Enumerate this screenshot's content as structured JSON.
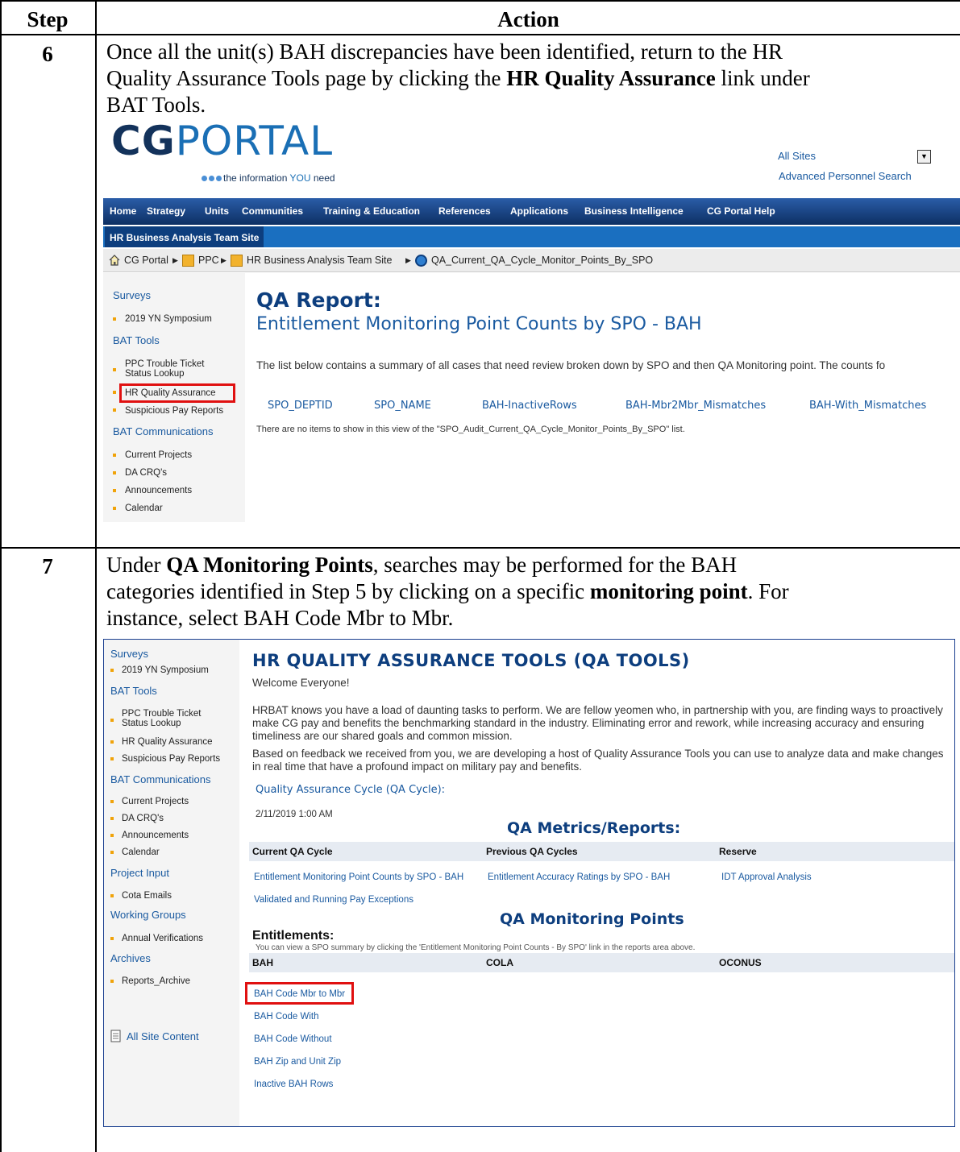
{
  "table": {
    "col_step": "Step",
    "col_action": "Action"
  },
  "step6": {
    "number": "6",
    "line1": "Once all the unit(s) BAH discrepancies have been identified, return to the HR",
    "line2_a": "Quality Assurance Tools page by clicking the ",
    "line2_b": "HR Quality Assurance",
    "line2_c": " link under",
    "line3": "BAT Tools."
  },
  "step7": {
    "number": "7",
    "line1_a": "Under ",
    "line1_b": "QA Monitoring Points",
    "line1_c": ", searches may be performed for the BAH",
    "line2_a": "categories identified in Step 5 by clicking on a specific ",
    "line2_b": "monitoring point",
    "line2_c": ".  For",
    "line3": "instance, select BAH Code Mbr to Mbr."
  },
  "shot1": {
    "logo_cg": "CG",
    "logo_portal": "PORTAL",
    "tagline_a": "the information ",
    "tagline_b": "YOU",
    "tagline_c": " need",
    "sites_value": "All Sites",
    "advanced_search": "Advanced Personnel Search",
    "topnav": [
      "Home",
      "Strategy",
      "Units",
      "Communities",
      "Training & Education",
      "References",
      "Applications",
      "Business Intelligence",
      "CG Portal Help"
    ],
    "subtab": "HR Business Analysis Team Site",
    "breadcrumb": [
      "CG Portal",
      "PPC",
      "HR Business Analysis Team Site",
      "QA_Current_QA_Cycle_Monitor_Points_By_SPO"
    ],
    "nav": {
      "surveys": "Surveys",
      "symposium": "2019 YN Symposium",
      "bat_tools": "BAT Tools",
      "ppc_ticket_1": "PPC Trouble Ticket",
      "ppc_ticket_2": "Status Lookup",
      "hr_qa": "HR Quality Assurance",
      "suspicious": "Suspicious Pay Reports",
      "bat_comm": "BAT Communications",
      "current_projects": "Current Projects",
      "da_crq": "DA CRQ's",
      "announcements": "Announcements",
      "calendar": "Calendar"
    },
    "report_title": "QA Report:",
    "report_subtitle": "Entitlement Monitoring Point Counts by SPO - BAH",
    "description": "The list below contains a summary of all cases that need review broken down by SPO and then QA Monitoring point. The counts fo",
    "columns": [
      "SPO_DEPTID",
      "SPO_NAME",
      "BAH-InactiveRows",
      "BAH-Mbr2Mbr_Mismatches",
      "BAH-With_Mismatches"
    ],
    "no_items": "There are no items to show in this view of the \"SPO_Audit_Current_QA_Cycle_Monitor_Points_By_SPO\" list."
  },
  "shot2": {
    "nav": {
      "surveys": "Surveys",
      "symposium": "2019 YN Symposium",
      "bat_tools": "BAT Tools",
      "ppc_ticket_1": "PPC Trouble Ticket",
      "ppc_ticket_2": "Status Lookup",
      "hr_qa": "HR Quality Assurance",
      "suspicious": "Suspicious Pay Reports",
      "bat_comm": "BAT Communications",
      "current_projects": "Current Projects",
      "da_crq": "DA CRQ's",
      "announcements": "Announcements",
      "calendar": "Calendar",
      "project_input": "Project Input",
      "cota": "Cota Emails",
      "working_groups": "Working Groups",
      "annual": "Annual Verifications",
      "archives": "Archives",
      "reports_archive": "Reports_Archive",
      "all_site": "All Site Content"
    },
    "title": "HR QUALITY ASSURANCE TOOLS (QA TOOLS)",
    "welcome": "Welcome Everyone!",
    "para1": "HRBAT knows you have a load of daunting tasks to perform.  We are fellow yeomen who, in partnership with you, are finding ways to proactively make CG pay and benefits the benchmarking standard in the industry.  Eliminating error and rework, while increasing accuracy and ensuring timeliness are our shared goals and common mission.",
    "para2": "Based on feedback we received from you, we are developing a host of Quality Assurance Tools you can use to analyze data and make changes in real time that have a profound impact on military pay and benefits.",
    "cycle_label": "Quality Assurance Cycle (QA Cycle):",
    "cycle_date": "2/11/2019 1:00 AM",
    "metrics_title": "QA Metrics/Reports:",
    "metrics_cols": [
      "Current QA Cycle",
      "Previous QA Cycles",
      "Reserve"
    ],
    "link_ent_counts": "Entitlement Monitoring Point Counts by SPO - BAH",
    "link_ent_accuracy": "Entitlement Accuracy Ratings by SPO - BAH",
    "link_idt": "IDT Approval Analysis",
    "link_validated": "Validated and Running Pay Exceptions",
    "monitoring_title": "QA Monitoring Points",
    "entitlements": "Entitlements:",
    "ent_note": "You can view a SPO summary by clicking the 'Entitlement Monitoring Point Counts - By SPO' link in the reports area above.",
    "ent_cols": [
      "BAH",
      "COLA",
      "OCONUS"
    ],
    "bah_links": [
      "BAH Code Mbr to Mbr",
      "BAH Code With",
      "BAH Code Without",
      "BAH Zip and Unit Zip",
      "Inactive BAH Rows"
    ]
  }
}
